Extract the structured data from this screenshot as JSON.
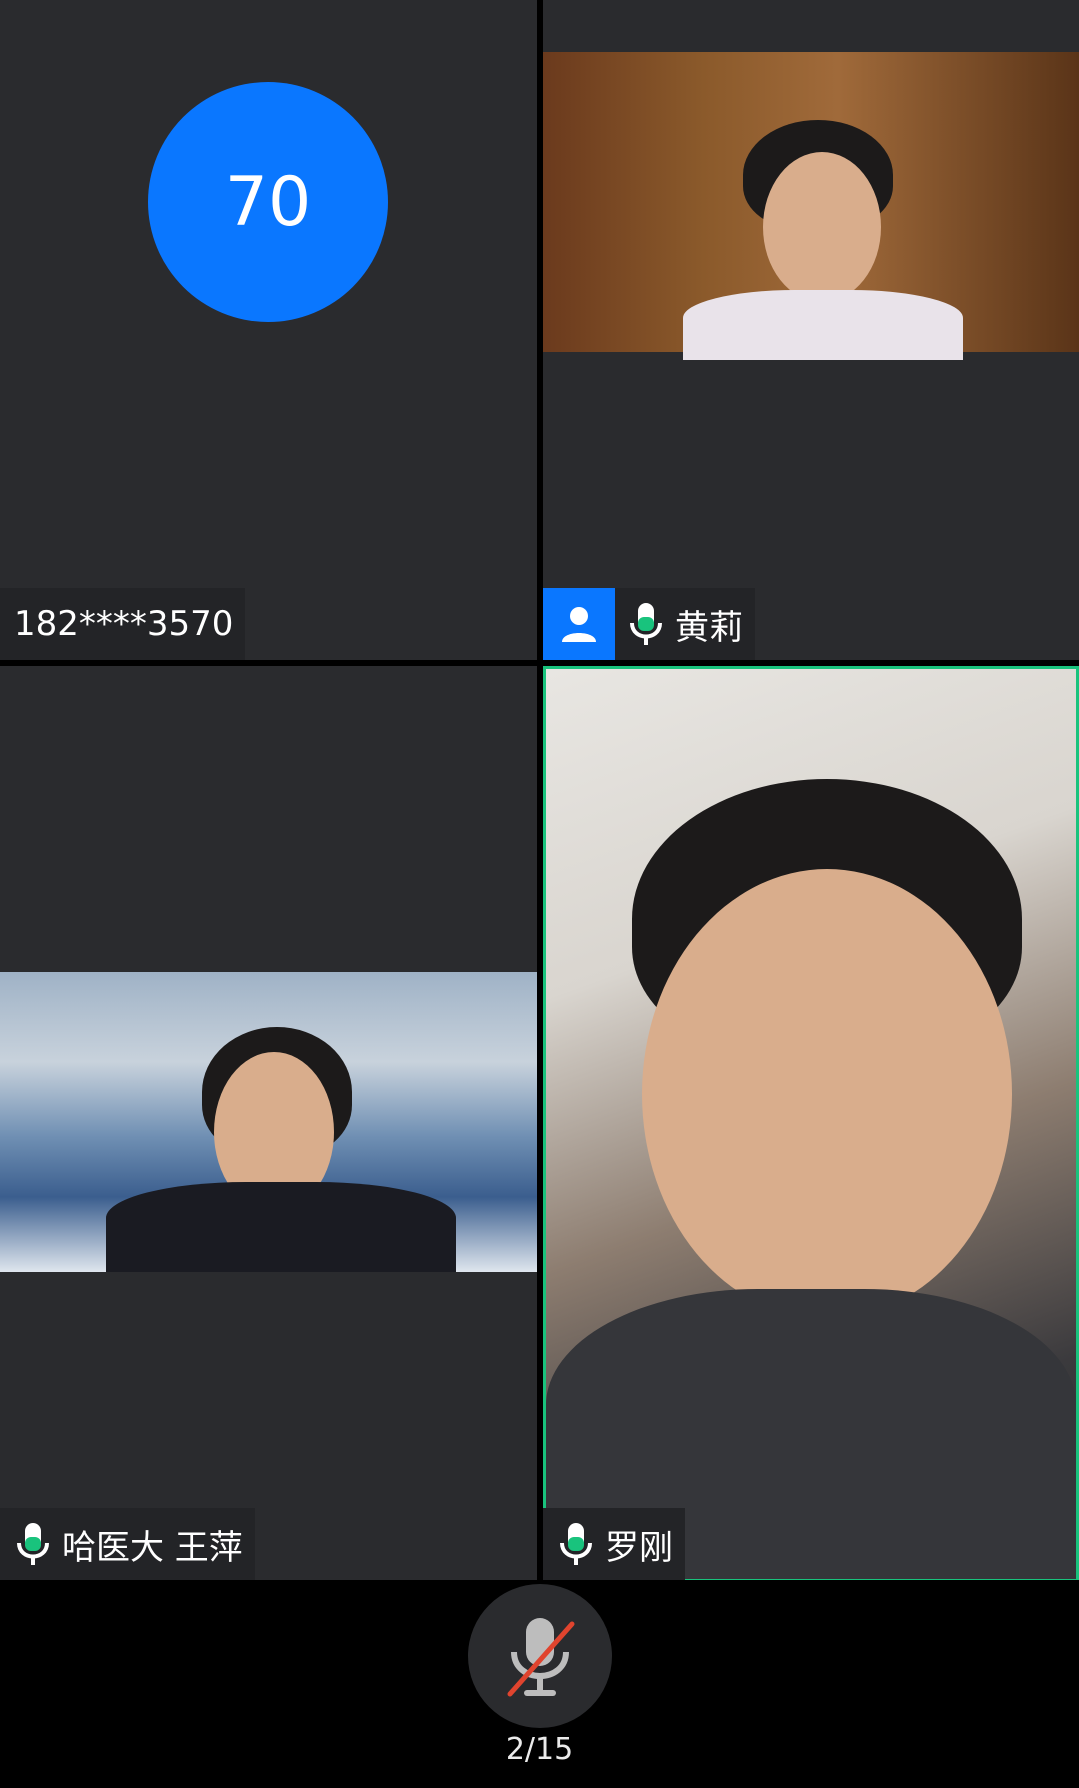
{
  "participants": [
    {
      "name": "182****3570",
      "avatar_number": "70",
      "mic": "none"
    },
    {
      "name": "黄莉",
      "mic": "on",
      "badge": "user-icon"
    },
    {
      "name": "哈医大  王萍",
      "mic": "on"
    },
    {
      "name": "罗刚",
      "mic": "on",
      "active_speaker": true
    }
  ],
  "footer": {
    "mute_icon": "mic-muted-icon",
    "page_indicator": "2/15"
  },
  "colors": {
    "accent_blue": "#0a77ff",
    "mic_green": "#19c37d",
    "tile_bg": "#2a2b2e",
    "active_border": "#19c37d"
  }
}
